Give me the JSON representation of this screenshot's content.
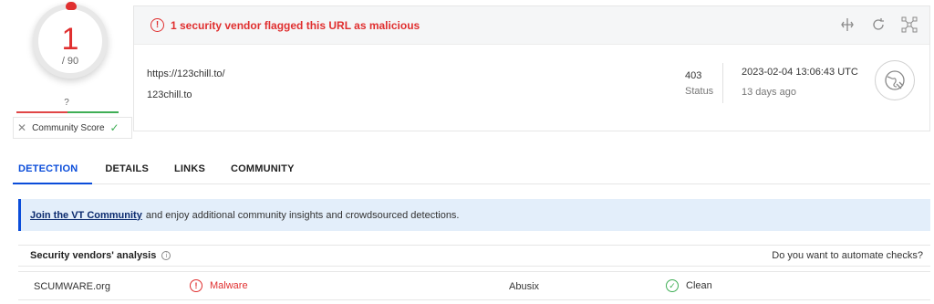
{
  "score": {
    "detections": "1",
    "total": "/ 90",
    "community_value": "?",
    "community_label": "Community Score"
  },
  "header": {
    "alert_text": "1 security vendor flagged this URL as malicious",
    "url": "https://123chill.to/",
    "domain": "123chill.to",
    "status_code": "403",
    "status_label": "Status",
    "date": "2023-02-04 13:06:43 UTC",
    "ago": "13 days ago"
  },
  "tabs": [
    {
      "label": "DETECTION"
    },
    {
      "label": "DETAILS"
    },
    {
      "label": "LINKS"
    },
    {
      "label": "COMMUNITY"
    }
  ],
  "banner": {
    "link": "Join the VT Community",
    "text": "and enjoy additional community insights and crowdsourced detections."
  },
  "vendors": {
    "title": "Security vendors' analysis",
    "automate": "Do you want to automate checks?",
    "rows": [
      {
        "vendor1": "SCUMWARE.org",
        "verdict1": "Malware",
        "vendor2": "Abusix",
        "verdict2": "Clean"
      }
    ]
  },
  "colors": {
    "danger": "#e02f2f",
    "accent": "#0b4dda",
    "clean": "#3fae55"
  }
}
